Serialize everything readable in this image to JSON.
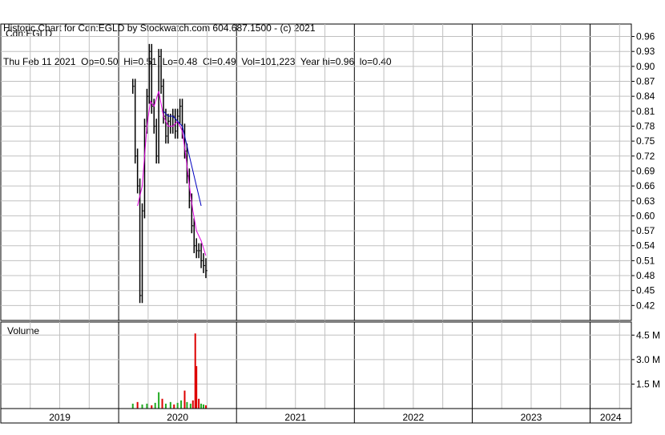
{
  "header": {
    "line1": "Historic Chart for Cdn:EGLD by Stockwatch.com 604.687.1500 - (c) 2021",
    "line2": "Thu Feb 11 2021  Op=0.50  Hi=0.51  Lo=0.48  Cl=0.49  Vol=101,223  Year hi=0.96  lo=0.40"
  },
  "colors": {
    "price_bar": "#000000",
    "ma_short": "#e000e0",
    "ma_long": "#0000c0",
    "volume_up": "#22aa22",
    "volume_down": "#dd0000",
    "grid": "#c0c0c0"
  },
  "chart_data": {
    "type": "line",
    "symbol": "Cdn:EGLD",
    "price_axis": {
      "ylim": [
        0.39,
        0.985
      ],
      "ticks": [
        "0.96",
        "0.93",
        "0.90",
        "0.87",
        "0.84",
        "0.81",
        "0.78",
        "0.75",
        "0.72",
        "0.69",
        "0.66",
        "0.63",
        "0.60",
        "0.57",
        "0.54",
        "0.51",
        "0.48",
        "0.45",
        "0.42"
      ]
    },
    "volume_axis": {
      "label": "Volume",
      "ylim": [
        0,
        5.3
      ],
      "ticks": [
        {
          "v": 4.5,
          "label": "4.5 M"
        },
        {
          "v": 3.0,
          "label": "3.0 M"
        },
        {
          "v": 1.5,
          "label": "1.5 M"
        }
      ]
    },
    "years": [
      {
        "label": "2019",
        "x_start": 2019.0,
        "x_end": 2020.0
      },
      {
        "label": "2020",
        "x_start": 2020.0,
        "x_end": 2021.0
      },
      {
        "label": "2021",
        "x_start": 2021.0,
        "x_end": 2022.0
      },
      {
        "label": "2022",
        "x_start": 2022.0,
        "x_end": 2023.0
      },
      {
        "label": "2023",
        "x_start": 2023.0,
        "x_end": 2024.0
      },
      {
        "label": "2024",
        "x_start": 2024.0,
        "x_end": 2024.35
      }
    ],
    "x_range": [
      2019.0,
      2024.35
    ],
    "price": [
      {
        "x": 2020.12,
        "close": 0.86
      },
      {
        "x": 2020.14,
        "close": 0.72
      },
      {
        "x": 2020.16,
        "close": 0.66
      },
      {
        "x": 2020.18,
        "close": 0.44
      },
      {
        "x": 2020.2,
        "close": 0.61
      },
      {
        "x": 2020.22,
        "close": 0.78
      },
      {
        "x": 2020.24,
        "close": 0.84
      },
      {
        "x": 2020.26,
        "close": 0.93
      },
      {
        "x": 2020.28,
        "close": 0.82
      },
      {
        "x": 2020.3,
        "close": 0.78
      },
      {
        "x": 2020.32,
        "close": 0.72
      },
      {
        "x": 2020.34,
        "close": 0.92
      },
      {
        "x": 2020.36,
        "close": 0.86
      },
      {
        "x": 2020.38,
        "close": 0.8
      },
      {
        "x": 2020.4,
        "close": 0.76
      },
      {
        "x": 2020.42,
        "close": 0.79
      },
      {
        "x": 2020.44,
        "close": 0.78
      },
      {
        "x": 2020.46,
        "close": 0.8
      },
      {
        "x": 2020.48,
        "close": 0.77
      },
      {
        "x": 2020.5,
        "close": 0.8
      },
      {
        "x": 2020.52,
        "close": 0.82
      },
      {
        "x": 2020.54,
        "close": 0.77
      },
      {
        "x": 2020.56,
        "close": 0.73
      },
      {
        "x": 2020.58,
        "close": 0.68
      },
      {
        "x": 2020.6,
        "close": 0.63
      },
      {
        "x": 2020.62,
        "close": 0.58
      },
      {
        "x": 2020.64,
        "close": 0.54
      },
      {
        "x": 2020.66,
        "close": 0.53
      },
      {
        "x": 2020.68,
        "close": 0.53
      },
      {
        "x": 2020.7,
        "close": 0.51
      },
      {
        "x": 2020.72,
        "close": 0.5
      },
      {
        "x": 2020.74,
        "close": 0.49
      }
    ],
    "ma_short": [
      {
        "x": 2020.16,
        "y": 0.62
      },
      {
        "x": 2020.2,
        "y": 0.66
      },
      {
        "x": 2020.24,
        "y": 0.78
      },
      {
        "x": 2020.27,
        "y": 0.83
      },
      {
        "x": 2020.3,
        "y": 0.82
      },
      {
        "x": 2020.34,
        "y": 0.85
      },
      {
        "x": 2020.38,
        "y": 0.8
      },
      {
        "x": 2020.42,
        "y": 0.78
      },
      {
        "x": 2020.46,
        "y": 0.78
      },
      {
        "x": 2020.5,
        "y": 0.79
      },
      {
        "x": 2020.54,
        "y": 0.77
      },
      {
        "x": 2020.57,
        "y": 0.72
      },
      {
        "x": 2020.6,
        "y": 0.66
      },
      {
        "x": 2020.63,
        "y": 0.61
      },
      {
        "x": 2020.66,
        "y": 0.57
      },
      {
        "x": 2020.7,
        "y": 0.55
      },
      {
        "x": 2020.74,
        "y": 0.52
      }
    ],
    "ma_long": [
      {
        "x": 2020.38,
        "y": 0.81
      },
      {
        "x": 2020.42,
        "y": 0.8
      },
      {
        "x": 2020.46,
        "y": 0.8
      },
      {
        "x": 2020.5,
        "y": 0.79
      },
      {
        "x": 2020.54,
        "y": 0.78
      },
      {
        "x": 2020.58,
        "y": 0.74
      },
      {
        "x": 2020.62,
        "y": 0.7
      },
      {
        "x": 2020.66,
        "y": 0.66
      },
      {
        "x": 2020.7,
        "y": 0.62
      }
    ],
    "volume": [
      {
        "x": 2020.12,
        "v": 0.3
      },
      {
        "x": 2020.16,
        "v": 0.4
      },
      {
        "x": 2020.2,
        "v": 0.25
      },
      {
        "x": 2020.24,
        "v": 0.3
      },
      {
        "x": 2020.28,
        "v": 0.2
      },
      {
        "x": 2020.31,
        "v": 0.35
      },
      {
        "x": 2020.34,
        "v": 1.0
      },
      {
        "x": 2020.37,
        "v": 0.6
      },
      {
        "x": 2020.4,
        "v": 0.3
      },
      {
        "x": 2020.44,
        "v": 0.4
      },
      {
        "x": 2020.47,
        "v": 0.25
      },
      {
        "x": 2020.5,
        "v": 0.35
      },
      {
        "x": 2020.53,
        "v": 0.5
      },
      {
        "x": 2020.56,
        "v": 1.1
      },
      {
        "x": 2020.58,
        "v": 0.4
      },
      {
        "x": 2020.61,
        "v": 0.3
      },
      {
        "x": 2020.63,
        "v": 0.5
      },
      {
        "x": 2020.65,
        "v": 4.6
      },
      {
        "x": 2020.66,
        "v": 2.6
      },
      {
        "x": 2020.68,
        "v": 0.6
      },
      {
        "x": 2020.7,
        "v": 0.3
      },
      {
        "x": 2020.72,
        "v": 0.25
      },
      {
        "x": 2020.74,
        "v": 0.2
      }
    ]
  }
}
